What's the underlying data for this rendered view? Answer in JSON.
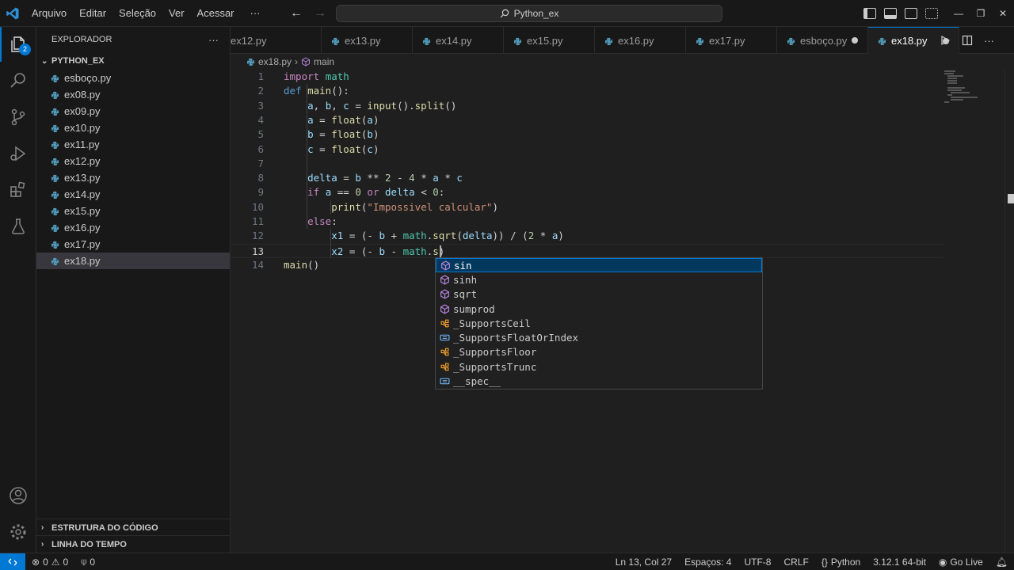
{
  "titlebar": {
    "menu": [
      "Arquivo",
      "Editar",
      "Seleção",
      "Ver",
      "Acessar",
      "···"
    ],
    "search_text": "Python_ex"
  },
  "activity_badge": "2",
  "sidebar": {
    "title": "EXPLORADOR",
    "more": "···",
    "folder": "PYTHON_EX",
    "files": [
      "esboço.py",
      "ex08.py",
      "ex09.py",
      "ex10.py",
      "ex11.py",
      "ex12.py",
      "ex13.py",
      "ex14.py",
      "ex15.py",
      "ex16.py",
      "ex17.py",
      "ex18.py"
    ],
    "selected_file": "ex18.py",
    "outline": "ESTRUTURA DO CÓDIGO",
    "timeline": "LINHA DO TEMPO"
  },
  "tabs": [
    {
      "label": "ex12.py",
      "active": false,
      "dirty": false
    },
    {
      "label": "ex13.py",
      "active": false,
      "dirty": false
    },
    {
      "label": "ex14.py",
      "active": false,
      "dirty": false
    },
    {
      "label": "ex15.py",
      "active": false,
      "dirty": false
    },
    {
      "label": "ex16.py",
      "active": false,
      "dirty": false
    },
    {
      "label": "ex17.py",
      "active": false,
      "dirty": false
    },
    {
      "label": "esboço.py",
      "active": false,
      "dirty": true
    },
    {
      "label": "ex18.py",
      "active": true,
      "dirty": true
    }
  ],
  "breadcrumb": {
    "file": "ex18.py",
    "symbol": "main"
  },
  "editor": {
    "current_line": 13,
    "lines": [
      {
        "n": "1",
        "t": "import math"
      },
      {
        "n": "2",
        "t": "def main():"
      },
      {
        "n": "3",
        "t": "    a, b, c = input().split()"
      },
      {
        "n": "4",
        "t": "    a = float(a)"
      },
      {
        "n": "5",
        "t": "    b = float(b)"
      },
      {
        "n": "6",
        "t": "    c = float(c)"
      },
      {
        "n": "7",
        "t": ""
      },
      {
        "n": "8",
        "t": "    delta = b ** 2 - 4 * a * c"
      },
      {
        "n": "9",
        "t": "    if a == 0 or delta < 0:"
      },
      {
        "n": "10",
        "t": "        print(\"Impossivel calcular\")"
      },
      {
        "n": "11",
        "t": "    else:"
      },
      {
        "n": "12",
        "t": "        x1 = (- b + math.sqrt(delta)) / (2 * a)"
      },
      {
        "n": "13",
        "t": "        x2 = (- b - math.s)"
      },
      {
        "n": "14",
        "t": "main()"
      }
    ]
  },
  "suggestions": [
    {
      "label": "sin",
      "kind": "module",
      "selected": true
    },
    {
      "label": "sinh",
      "kind": "module",
      "selected": false
    },
    {
      "label": "sqrt",
      "kind": "module",
      "selected": false
    },
    {
      "label": "sumprod",
      "kind": "module",
      "selected": false
    },
    {
      "label": "_SupportsCeil",
      "kind": "class",
      "selected": false
    },
    {
      "label": "_SupportsFloatOrIndex",
      "kind": "variable",
      "selected": false
    },
    {
      "label": "_SupportsFloor",
      "kind": "class",
      "selected": false
    },
    {
      "label": "_SupportsTrunc",
      "kind": "class",
      "selected": false
    },
    {
      "label": "__spec__",
      "kind": "variable",
      "selected": false
    }
  ],
  "statusbar": {
    "errors": "0",
    "warnings": "0",
    "ports": "0",
    "position": "Ln 13, Col 27",
    "indent": "Espaços: 4",
    "encoding": "UTF-8",
    "eol": "CRLF",
    "language": "Python",
    "interpreter": "3.12.1 64-bit",
    "golive": "Go Live"
  },
  "colors": {
    "accent": "#0078d4",
    "keyword": "#c586c0",
    "function": "#dcdcaa",
    "variable": "#9cdcfe",
    "string": "#ce9178",
    "number": "#b5cea8"
  }
}
